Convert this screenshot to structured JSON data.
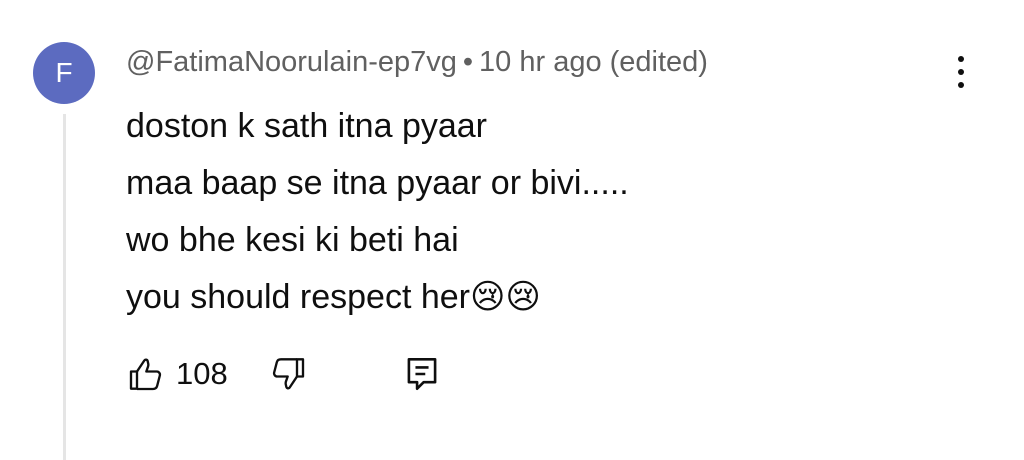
{
  "comment": {
    "avatar_letter": "F",
    "avatar_color": "#5c6bc0",
    "author": "@FatimaNoorulain-ep7vg",
    "separator": "•",
    "time": "10 hr ago (edited)",
    "lines": [
      "doston k sath itna pyaar",
      "maa baap se itna pyaar or bivi.....",
      "wo bhe kesi ki beti hai",
      "you should respect her😢😢"
    ],
    "likes": "108",
    "icons": {
      "more": "more-vertical-icon",
      "like": "thumb-up-icon",
      "dislike": "thumb-down-icon",
      "reply": "reply-comment-icon"
    }
  }
}
